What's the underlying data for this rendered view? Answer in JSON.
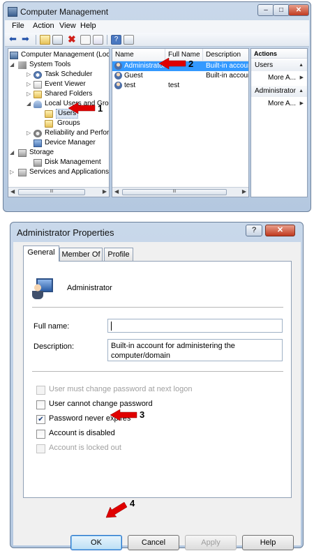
{
  "computer_management": {
    "title": "Computer Management",
    "menu": [
      "File",
      "Action",
      "View",
      "Help"
    ],
    "tree": [
      {
        "label": "Computer Management (Local",
        "icon": "computer-management-icon"
      },
      {
        "label": "System Tools",
        "icon": "tools-icon"
      },
      {
        "label": "Task Scheduler",
        "icon": "clock-icon"
      },
      {
        "label": "Event Viewer",
        "icon": "event-viewer-icon"
      },
      {
        "label": "Shared Folders",
        "icon": "shared-folders-icon"
      },
      {
        "label": "Local Users and Groups",
        "icon": "users-groups-icon"
      },
      {
        "label": "Users",
        "icon": "folder-icon"
      },
      {
        "label": "Groups",
        "icon": "folder-icon"
      },
      {
        "label": "Reliability and Performa",
        "icon": "performance-icon"
      },
      {
        "label": "Device Manager",
        "icon": "device-manager-icon"
      },
      {
        "label": "Storage",
        "icon": "storage-icon"
      },
      {
        "label": "Disk Management",
        "icon": "disk-icon"
      },
      {
        "label": "Services and Applications",
        "icon": "services-icon"
      }
    ],
    "columns": [
      "Name",
      "Full Name",
      "Description"
    ],
    "rows": [
      {
        "name": "Administrator",
        "full_name": "",
        "description": "Built-in accoun"
      },
      {
        "name": "Guest",
        "full_name": "",
        "description": "Built-in accoun"
      },
      {
        "name": "test",
        "full_name": "test",
        "description": ""
      }
    ],
    "actions": {
      "header": "Actions",
      "sections": [
        {
          "title": "Users",
          "item": "More A..."
        },
        {
          "title": "Administrator",
          "item": "More A..."
        }
      ]
    },
    "scroll_thumb": "III"
  },
  "properties": {
    "title": "Administrator Properties",
    "help_label": "?",
    "tabs": [
      "General",
      "Member Of",
      "Profile"
    ],
    "user_name": "Administrator",
    "full_name_label": "Full name:",
    "full_name_value": "",
    "description_label": "Description:",
    "description_value": "Built-in account for administering the computer/domain",
    "checkboxes": [
      {
        "label": "User must change password at next logon",
        "checked": false,
        "disabled": true
      },
      {
        "label": "User cannot change password",
        "checked": false,
        "disabled": false
      },
      {
        "label": "Password never expires",
        "checked": true,
        "disabled": false
      },
      {
        "label": "Account is disabled",
        "checked": false,
        "disabled": false
      },
      {
        "label": "Account is locked out",
        "checked": false,
        "disabled": true
      }
    ],
    "buttons": {
      "ok": "OK",
      "cancel": "Cancel",
      "apply": "Apply",
      "help": "Help"
    }
  },
  "callouts": [
    "1",
    "2",
    "3",
    "4"
  ],
  "colors": {
    "selection": "#3399ff",
    "arrow": "#e00000",
    "title_bg": "#c9d8ea",
    "close": "#c0391f"
  }
}
